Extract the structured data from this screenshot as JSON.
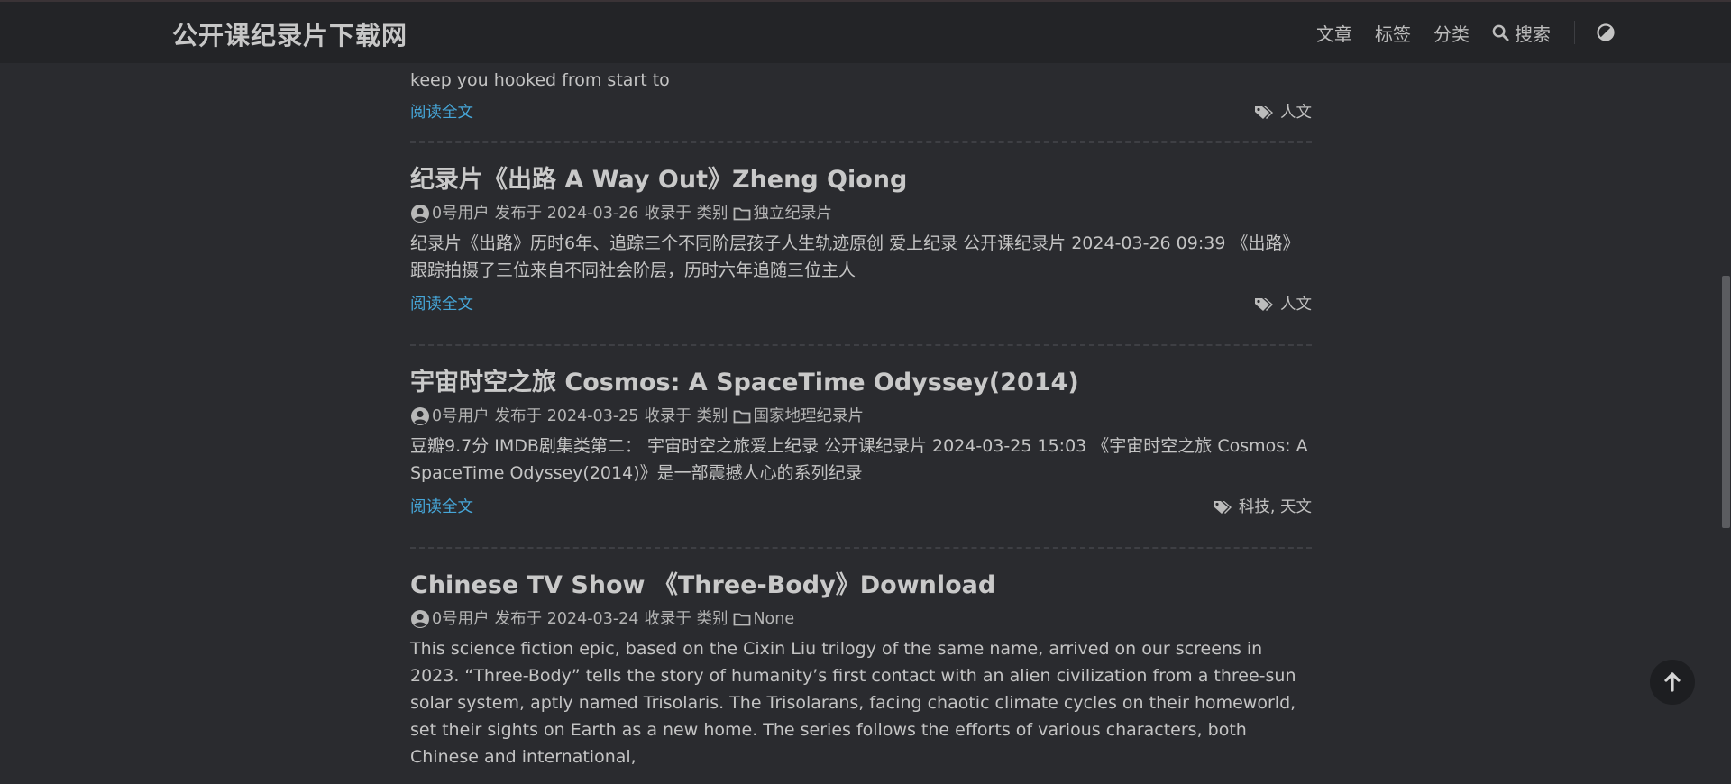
{
  "header": {
    "site_title": "公开课纪录片下载网",
    "nav": [
      {
        "label": "文章"
      },
      {
        "label": "标签"
      },
      {
        "label": "分类"
      },
      {
        "label": "搜索",
        "icon": "search-icon"
      }
    ],
    "theme_toggle_icon": "contrast-icon"
  },
  "partial_post": {
    "summary_tail": "keep you hooked from start to",
    "read_more": "阅读全文",
    "tags": "人文"
  },
  "posts": [
    {
      "title": "纪录片《出路 A Way Out》Zheng Qiong",
      "author": "0号用户",
      "published": "发布于 2024-03-26",
      "collected": "收录于 类别",
      "category": "独立纪录片",
      "summary": "纪录片《出路》历时6年、追踪三个不同阶层孩子人生轨迹原创 爱上纪录 公开课纪录片 2024-03-26 09:39 《出路》跟踪拍摄了三位来自不同社会阶层，历时六年追随三位主人",
      "read_more": "阅读全文",
      "tags": "人文"
    },
    {
      "title": "宇宙时空之旅 Cosmos: A SpaceTime Odyssey(2014)",
      "author": "0号用户",
      "published": "发布于 2024-03-25",
      "collected": "收录于 类别",
      "category": "国家地理纪录片",
      "summary": "豆瓣9.7分 IMDB剧集类第二： 宇宙时空之旅爱上纪录 公开课纪录片 2024-03-25 15:03 《宇宙时空之旅 Cosmos: A SpaceTime Odyssey(2014)》是一部震撼人心的系列纪录",
      "read_more": "阅读全文",
      "tags": "科技, 天文"
    },
    {
      "title": "Chinese TV Show 《Three-Body》Download",
      "author": "0号用户",
      "published": "发布于 2024-03-24",
      "collected": "收录于 类别",
      "category": "None",
      "summary": "This science fiction epic, based on the Cixin Liu trilogy of the same name, arrived on our screens in 2023. “Three-Body” tells the story of humanity’s first contact with an alien civilization from a three-sun solar system, aptly named Trisolaris. The Trisolarans, facing chaotic climate cycles on their homeworld, set their sights on Earth as a new home. The series follows the efforts of various characters, both Chinese and international,"
    }
  ],
  "back_to_top_icon": "arrow-up-icon"
}
